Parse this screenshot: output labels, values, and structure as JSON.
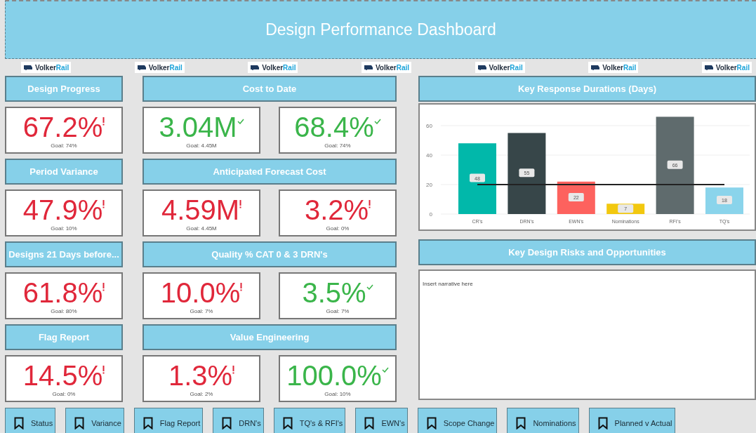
{
  "title": "Design Performance Dashboard",
  "logos": [
    {
      "text_1": "Volker",
      "text_2": "Rail"
    },
    {
      "text_1": "Volker",
      "text_2": "Rail"
    },
    {
      "text_1": "Volker",
      "text_2": "Rail"
    },
    {
      "text_1": "Volker",
      "text_2": "Rail"
    },
    {
      "text_1": "Volker",
      "text_2": "Rail"
    },
    {
      "text_1": "Volker",
      "text_2": "Rail"
    },
    {
      "text_1": "Volker",
      "text_2": "Rail"
    }
  ],
  "kpi_groups": [
    {
      "title": "Design Progress",
      "cards": [
        {
          "value": "67.2%",
          "goal": "Goal: 74%",
          "kind": "bad"
        }
      ]
    },
    {
      "title": "Cost to Date",
      "cards": [
        {
          "value": "3.04M",
          "goal": "Goal: 4.45M",
          "kind": "good"
        },
        {
          "value": "68.4%",
          "goal": "Goal: 74%",
          "kind": "good"
        }
      ]
    },
    {
      "title": "Period Variance",
      "cards": [
        {
          "value": "47.9%",
          "goal": "Goal: 10%",
          "kind": "bad"
        }
      ]
    },
    {
      "title": "Anticipated Forecast Cost",
      "cards": [
        {
          "value": "4.59M",
          "goal": "Goal: 4.45M",
          "kind": "bad"
        },
        {
          "value": "3.2%",
          "goal": "Goal: 0%",
          "kind": "bad"
        }
      ]
    },
    {
      "title": "Designs 21 Days before...",
      "cards": [
        {
          "value": "61.8%",
          "goal": "Goal: 80%",
          "kind": "bad"
        }
      ]
    },
    {
      "title": "Quality % CAT 0 & 3 DRN's",
      "cards": [
        {
          "value": "10.0%",
          "goal": "Goal: 7%",
          "kind": "bad"
        },
        {
          "value": "3.5%",
          "goal": "Goal: 7%",
          "kind": "good"
        }
      ]
    },
    {
      "title": "Flag Report",
      "cards": [
        {
          "value": "14.5%",
          "goal": "Goal: 0%",
          "kind": "bad"
        }
      ]
    },
    {
      "title": "Value Engineering",
      "cards": [
        {
          "value": "1.3%",
          "goal": "Goal: 2%",
          "kind": "bad"
        },
        {
          "value": "100.0%",
          "goal": "Goal: 10%",
          "kind": "good"
        }
      ]
    }
  ],
  "response_chart": {
    "chart_data": {
      "type": "bar",
      "title": "Key Response Durations (Days)",
      "categories": [
        "CR's",
        "DRN's",
        "EWN's",
        "Nominations",
        "RFI's",
        "TQ's"
      ],
      "series": [
        {
          "color": "#01b8aa",
          "values": [
            48,
            null,
            null,
            null,
            null,
            null
          ]
        },
        {
          "color": "#374649",
          "values": [
            null,
            55,
            null,
            null,
            null,
            null
          ]
        },
        {
          "color": "#fd625e",
          "values": [
            null,
            null,
            22,
            null,
            null,
            null
          ]
        },
        {
          "color": "#f2c80f",
          "values": [
            null,
            null,
            null,
            7,
            null,
            null
          ]
        },
        {
          "color": "#5f6b6d",
          "values": [
            null,
            null,
            null,
            null,
            66,
            null
          ]
        },
        {
          "color": "#8ad4eb",
          "values": [
            null,
            null,
            null,
            null,
            null,
            18
          ]
        },
        {
          "type": "line",
          "color": "#222222",
          "values": [
            20,
            20,
            20,
            20,
            20,
            20
          ]
        }
      ],
      "ylim": [
        0,
        66
      ],
      "yticks": [
        0,
        20,
        40,
        60
      ],
      "grid": true,
      "value_labels": [
        [
          "48",
          null,
          null,
          null,
          null,
          null
        ],
        [
          null,
          "55",
          null,
          null,
          null,
          null
        ],
        [
          null,
          null,
          "22",
          null,
          null,
          null
        ],
        [
          null,
          null,
          null,
          "7",
          null,
          null
        ],
        [
          null,
          null,
          null,
          null,
          "66",
          null
        ],
        [
          null,
          null,
          null,
          null,
          null,
          "18"
        ],
        [
          null,
          null,
          null,
          null,
          null,
          null
        ]
      ]
    }
  },
  "risks": {
    "title": "Key Design Risks and Opportunities",
    "text": "Insert narrative here"
  },
  "bookmarks": [
    {
      "label": "Status"
    },
    {
      "label": "Variance"
    },
    {
      "label": "Flag Report"
    },
    {
      "label": "DRN's"
    },
    {
      "label": "TQ's & RFI's"
    },
    {
      "label": "EWN's"
    },
    {
      "label": "Scope Change"
    },
    {
      "label": "Nominations"
    },
    {
      "label": "Planned v Actual"
    }
  ]
}
